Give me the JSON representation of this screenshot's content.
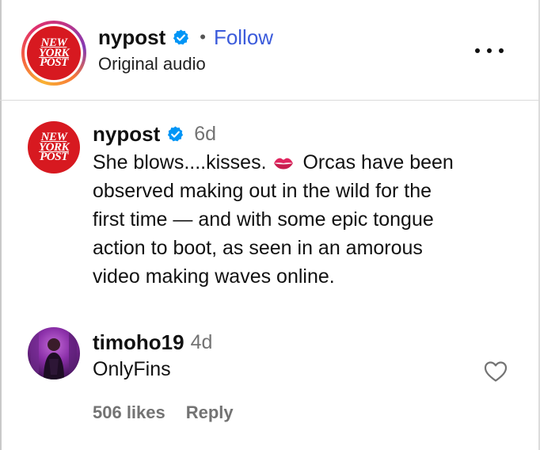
{
  "header": {
    "username": "nypost",
    "separator": "•",
    "follow_label": "Follow",
    "audio_label": "Original audio",
    "logo_lines": [
      "NEW",
      "YORK",
      "POST"
    ]
  },
  "caption": {
    "username": "nypost",
    "time": "6d",
    "emoji_icon": "kiss-mark-icon",
    "lines": [
      {
        "before": "She blows....kisses.",
        "after": "Orcas have been"
      },
      {
        "text": "observed making out in the wild for the"
      },
      {
        "text": "first time — and with some epic tongue"
      },
      {
        "text": "action to boot, as seen in an amorous"
      },
      {
        "text": "video making waves online."
      }
    ]
  },
  "comment": {
    "username": "timoho19",
    "time": "4d",
    "text": "OnlyFins",
    "likes": "506 likes",
    "reply_label": "Reply"
  },
  "colors": {
    "accent_blue": "#3b5bdb",
    "verified_blue": "#0095f6",
    "nypost_red": "#d71920",
    "muted_gray": "#737373"
  }
}
